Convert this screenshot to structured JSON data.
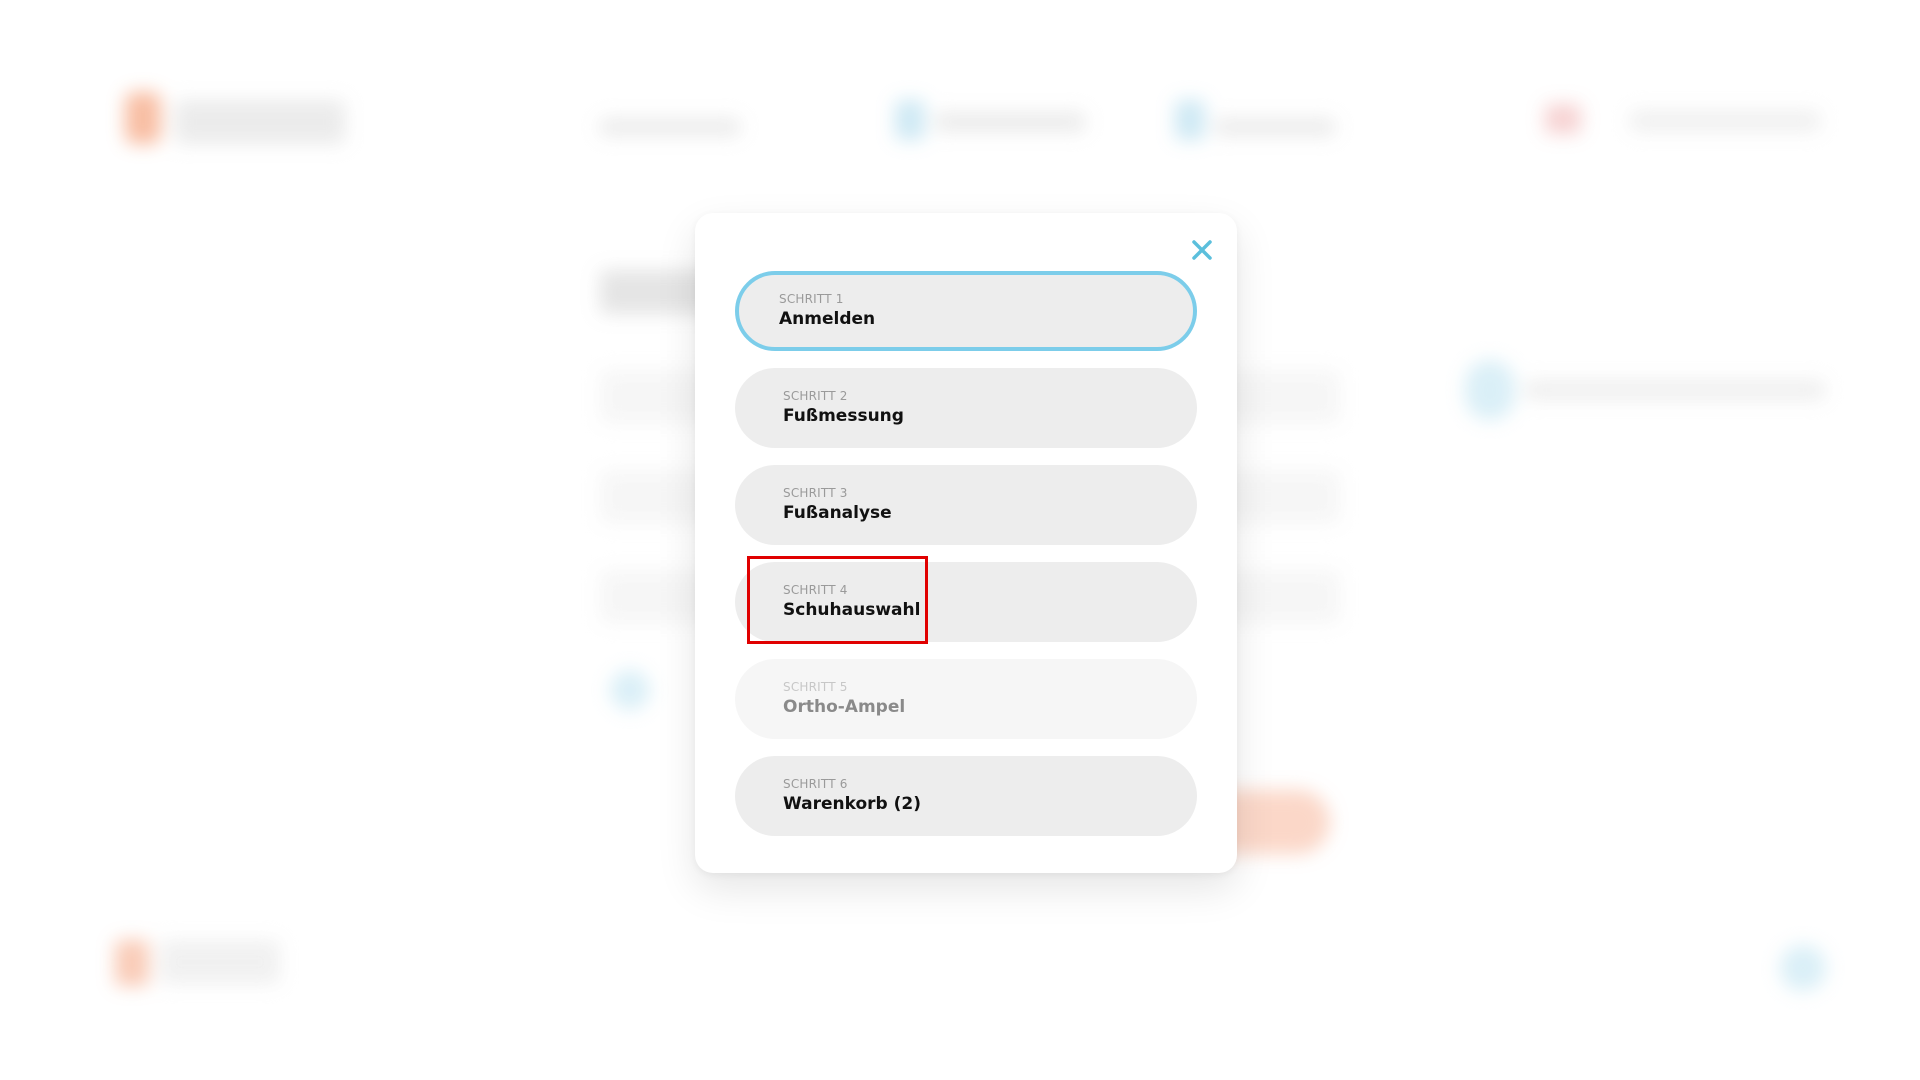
{
  "modal": {
    "close_icon": "close-icon",
    "accent_color": "#5bbfdc",
    "steps": [
      {
        "kicker": "SCHRITT 1",
        "title": "Anmelden",
        "state": "active"
      },
      {
        "kicker": "SCHRITT 2",
        "title": "Fußmessung",
        "state": "default"
      },
      {
        "kicker": "SCHRITT 3",
        "title": "Fußanalyse",
        "state": "default"
      },
      {
        "kicker": "SCHRITT 4",
        "title": "Schuhauswahl",
        "state": "default"
      },
      {
        "kicker": "SCHRITT 5",
        "title": "Ortho-Ampel",
        "state": "disabled"
      },
      {
        "kicker": "SCHRITT 6",
        "title": "Warenkorb (2)",
        "state": "default"
      }
    ]
  },
  "colors": {
    "active_border": "#7ccdea",
    "step_bg": "#ededed",
    "highlight": "#e00000",
    "brand_orange": "#f2733f"
  }
}
